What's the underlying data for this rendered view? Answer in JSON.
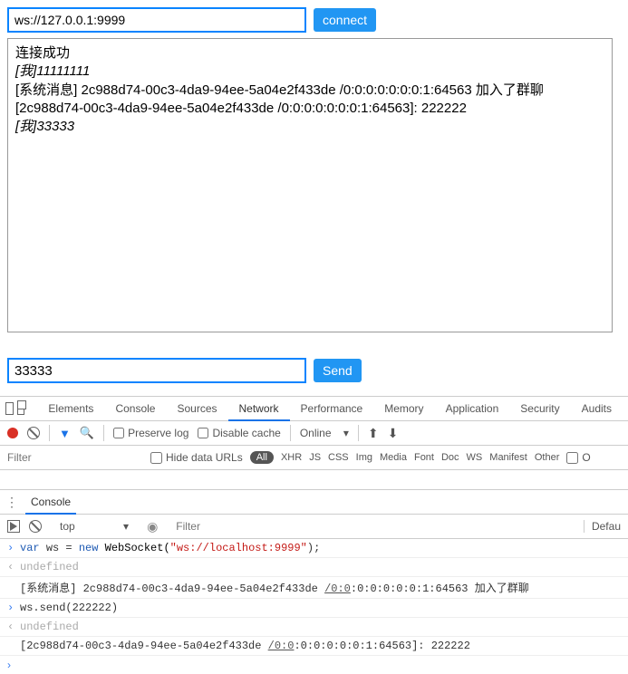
{
  "app": {
    "ws_url": "ws://127.0.0.1:9999",
    "connect_label": "connect",
    "send_label": "Send",
    "msg_value": "33333",
    "log": [
      {
        "html": "连接成功",
        "italic": false
      },
      {
        "html": "[我]11111111",
        "italic": true
      },
      {
        "html": "[系统消息] 2c988d74-00c3-4da9-94ee-5a04e2f433de /0:0:0:0:0:0:0:1:64563 加入了群聊",
        "italic": false
      },
      {
        "html": "[2c988d74-00c3-4da9-94ee-5a04e2f433de /0:0:0:0:0:0:0:1:64563]: 222222",
        "italic": false
      },
      {
        "html": "[我]33333",
        "italic": true
      }
    ]
  },
  "devtools": {
    "tabs": [
      "Elements",
      "Console",
      "Sources",
      "Network",
      "Performance",
      "Memory",
      "Application",
      "Security",
      "Audits"
    ],
    "active_tab": "Network",
    "toolbar": {
      "preserve_log_label": "Preserve log",
      "disable_cache_label": "Disable cache",
      "throttle_value": "Online"
    },
    "filter": {
      "placeholder": "Filter",
      "hide_data_label": "Hide data URLs",
      "all_label": "All",
      "types": [
        "XHR",
        "JS",
        "CSS",
        "Img",
        "Media",
        "Font",
        "Doc",
        "WS",
        "Manifest",
        "Other"
      ],
      "trailing_checkbox_label": "O"
    },
    "drawer": {
      "tab": "Console",
      "context": "top",
      "filter_placeholder": "Filter",
      "end_label": "Defau"
    },
    "console": [
      {
        "type": "input",
        "tokens": [
          {
            "t": "var ",
            "c": "kw"
          },
          {
            "t": "ws = ",
            "c": ""
          },
          {
            "t": "new ",
            "c": "newkw"
          },
          {
            "t": "WebSocket(",
            "c": "cls"
          },
          {
            "t": "\"ws://localhost:9999\"",
            "c": "str"
          },
          {
            "t": ");",
            "c": ""
          }
        ]
      },
      {
        "type": "output",
        "text": "undefined",
        "cls": "undef"
      },
      {
        "type": "log",
        "prefix": "[系统消息] 2c988d74-00c3-4da9-94ee-5a04e2f433de ",
        "link": "/0:0",
        "suffix": ":0:0:0:0:0:1:64563 加入了群聊"
      },
      {
        "type": "input",
        "tokens": [
          {
            "t": "ws.send(",
            "c": ""
          },
          {
            "t": "222222",
            "c": "num"
          },
          {
            "t": ")",
            "c": ""
          }
        ]
      },
      {
        "type": "output",
        "text": "undefined",
        "cls": "undef"
      },
      {
        "type": "log",
        "prefix": "[2c988d74-00c3-4da9-94ee-5a04e2f433de ",
        "link": "/0:0",
        "suffix": ":0:0:0:0:0:1:64563]: 222222"
      }
    ]
  }
}
